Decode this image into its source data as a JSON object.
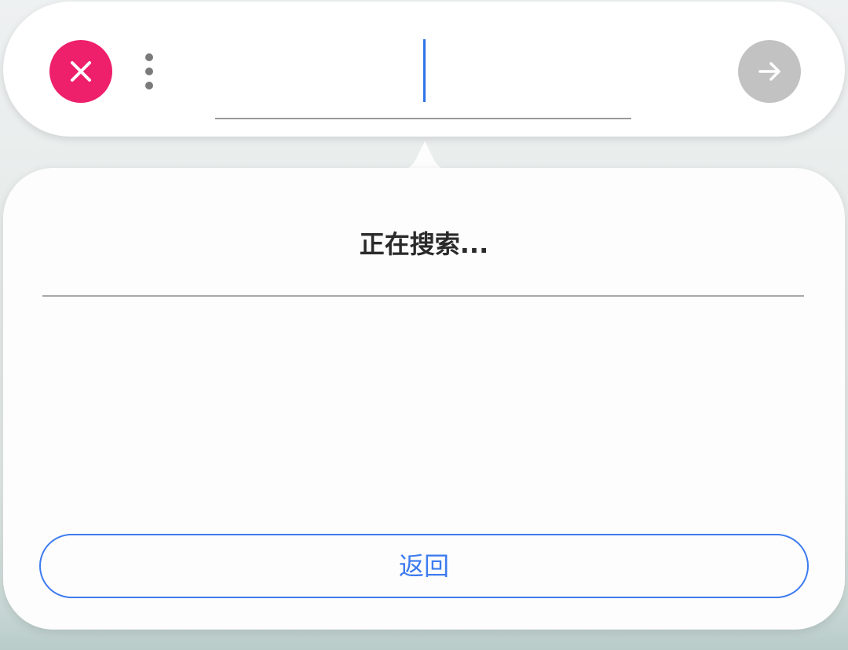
{
  "search_bar": {
    "close_icon": "close-icon",
    "more_icon": "more-vertical-icon",
    "go_icon": "arrow-right-icon",
    "input_value": "",
    "colors": {
      "close": "#ee1f6b",
      "go_disabled": "#c2c2c2",
      "caret": "#2f73ea"
    }
  },
  "panel": {
    "status": "正在搜索...",
    "back_label": "返回",
    "accent": "#3d7bef"
  }
}
